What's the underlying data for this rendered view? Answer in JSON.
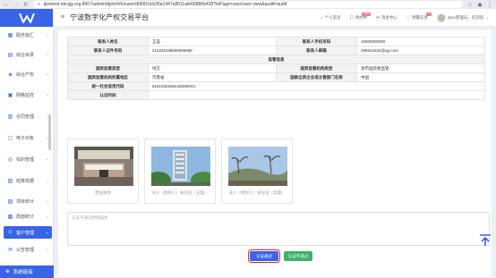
{
  "browser": {
    "url": "dpmtest.nbcqjy.org:8667/admin/dpm/#/to/user/d06810cb35e1447a8511afe65886b428?toPage=user/user-view&audit=audit"
  },
  "sidebar": {
    "items": [
      {
        "label": "服务窗汇",
        "icon": "grid-icon"
      },
      {
        "label": "综合目录",
        "icon": "folder-icon"
      },
      {
        "label": "综合产权",
        "icon": "shield-icon"
      },
      {
        "label": "网格监控",
        "icon": "monitor-icon"
      },
      {
        "label": "合同管理",
        "icon": "contract-icon"
      },
      {
        "label": "电子对象",
        "icon": "device-icon"
      },
      {
        "label": "标的管理",
        "icon": "target-icon"
      },
      {
        "label": "结算单据",
        "icon": "receipt-icon"
      },
      {
        "label": "项目统计",
        "icon": "chart-icon"
      },
      {
        "label": "局部统计",
        "icon": "stats-icon"
      },
      {
        "label": "客户管理",
        "icon": "user-icon",
        "active": true
      },
      {
        "label": "公告管理",
        "icon": "notice-icon"
      }
    ],
    "system_link": "系统链接"
  },
  "header": {
    "title": "宁波数字化产权交易平台",
    "links": [
      {
        "label": "个人首页",
        "icon": "home-icon"
      },
      {
        "label": "待办中",
        "icon": "todo-icon",
        "badge": "999"
      },
      {
        "label": "消息中心",
        "icon": "message-icon"
      },
      {
        "label": "预警信息",
        "icon": "warning-icon",
        "badge": "9"
      }
    ],
    "user": "dpm管理员，欢迎您"
  },
  "detail": {
    "rows": [
      {
        "k1": "联系人姓名",
        "v1": "王昊",
        "k2": "联系人手机号码",
        "v2": "15000000000"
      },
      {
        "k1": "联系人证件号码",
        "v1": "410331198606066699",
        "k2": "联系人邮箱",
        "v2": "295641532@qq.com"
      }
    ],
    "section_title": "监管信息",
    "rows2": [
      {
        "k1": "国资监管类型",
        "v1": "地方",
        "k2": "国资监管机构类型",
        "v2": "地市国资委监管"
      },
      {
        "k1": "国资监管机构所属地区",
        "v1": "河南省",
        "k2": "国家出资企业或主管部门名称",
        "v2": "中国"
      },
      {
        "k1": "统一社会信用代码",
        "v1": "91510302064456080XC",
        "k2": "",
        "v2": ""
      },
      {
        "k1": "认证时间",
        "v1": "",
        "k2": "",
        "v2": ""
      }
    ]
  },
  "images": [
    {
      "caption": "营业执照"
    },
    {
      "caption": "法人（授权人）身份证（正面）"
    },
    {
      "caption": "法人（授权人）身份证（反面）"
    }
  ],
  "remark": {
    "placeholder": "认证不通过原因描述"
  },
  "buttons": {
    "pass": "认证通过",
    "reject": "认证不通过"
  }
}
